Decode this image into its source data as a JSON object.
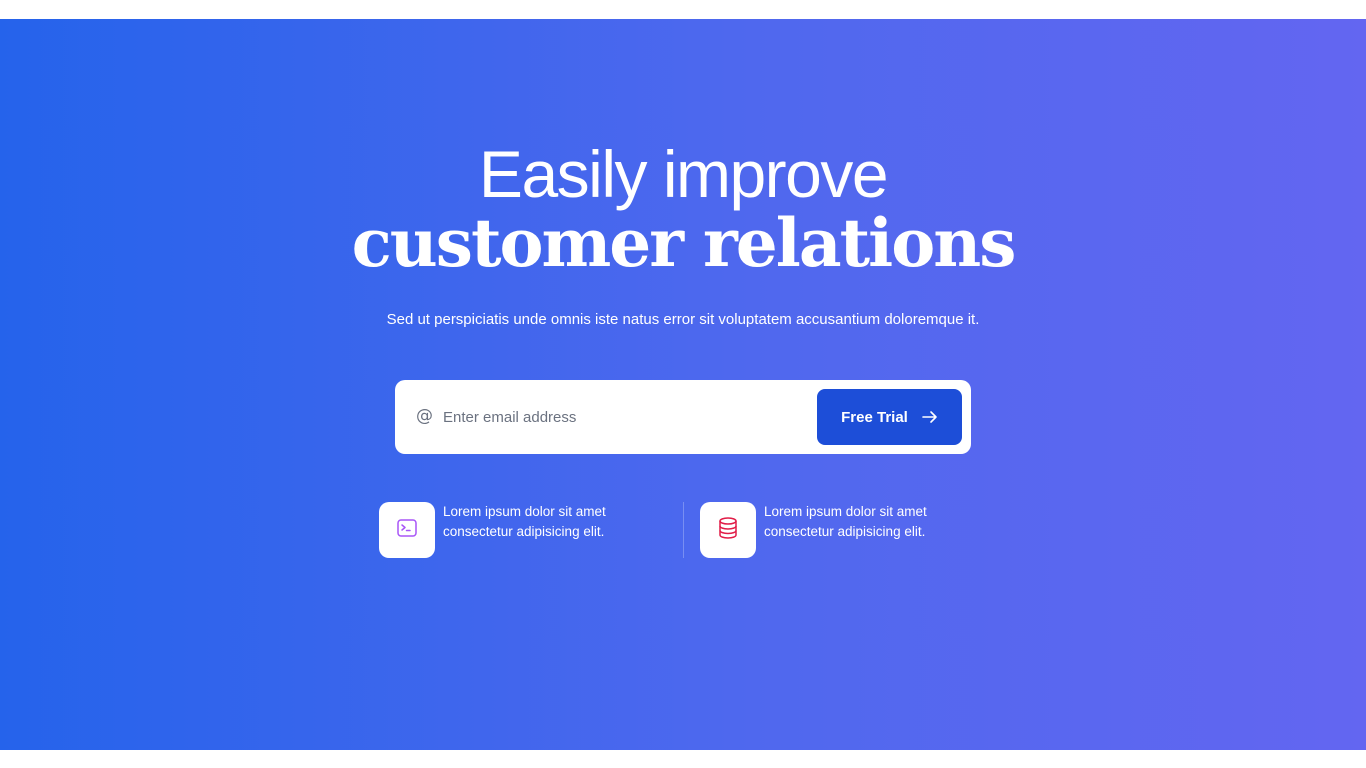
{
  "hero": {
    "headline_light": "Easily improve",
    "headline_bold": "customer relations",
    "subtitle": "Sed ut perspiciatis unde omnis iste natus error sit voluptatem accusantium doloremque it.",
    "gradient_start": "#2563eb",
    "gradient_end": "#6366f1"
  },
  "form": {
    "email_icon": "at-icon",
    "email_placeholder": "Enter email address",
    "email_value": "",
    "button_label": "Free Trial",
    "button_icon": "arrow-right-icon",
    "button_color": "#1d4ed8"
  },
  "features": [
    {
      "icon": "terminal-icon",
      "icon_color": "#a855f7",
      "line1": "Lorem ipsum dolor sit amet",
      "line2": "consectetur adipisicing elit."
    },
    {
      "icon": "database-icon",
      "icon_color": "#e11d48",
      "line1": "Lorem ipsum dolor sit amet",
      "line2": "consectetur adipisicing elit."
    }
  ]
}
